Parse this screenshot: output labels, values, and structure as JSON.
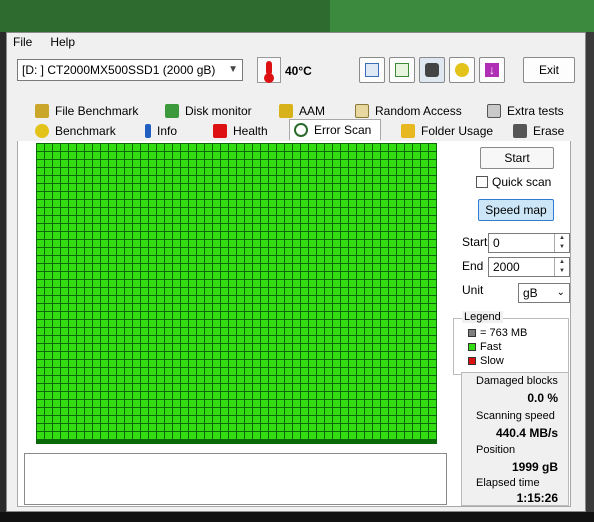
{
  "menu": {
    "file": "File",
    "help": "Help"
  },
  "toolbar": {
    "drive": "[D: ] CT2000MX500SSD1 (2000 gB)",
    "temperature": "40°C",
    "buttons": [
      "copy-info-icon",
      "copy-text-icon",
      "screenshot-camera-icon",
      "options-tools-icon",
      "save-down-icon"
    ],
    "exit_label": "Exit"
  },
  "tabs": {
    "row1": [
      "File Benchmark",
      "Disk monitor",
      "AAM",
      "Random Access",
      "Extra tests"
    ],
    "row2": [
      "Benchmark",
      "Info",
      "Health",
      "Error Scan",
      "Folder Usage",
      "Erase"
    ],
    "active": "Error Scan"
  },
  "scan": {
    "start_button": "Start",
    "quick_scan_label": "Quick scan",
    "quick_scan_checked": false,
    "speed_map_button": "Speed map",
    "start_label": "Start",
    "start_value": "0",
    "end_label": "End",
    "end_value": "2000",
    "unit_label": "Unit",
    "unit_value": "gB"
  },
  "legend": {
    "title": "Legend",
    "block_size": "= 763 MB",
    "fast": "Fast",
    "slow": "Slow",
    "colors": {
      "block": "#808080",
      "fast": "#33dd11",
      "slow": "#dd1111"
    }
  },
  "stats": {
    "damaged_label": "Damaged blocks",
    "damaged_value": "0.0 %",
    "speed_label": "Scanning speed",
    "speed_value": "440.4 MB/s",
    "position_label": "Position",
    "position_value": "1999 gB",
    "elapsed_label": "Elapsed time",
    "elapsed_value": "1:15:26"
  }
}
